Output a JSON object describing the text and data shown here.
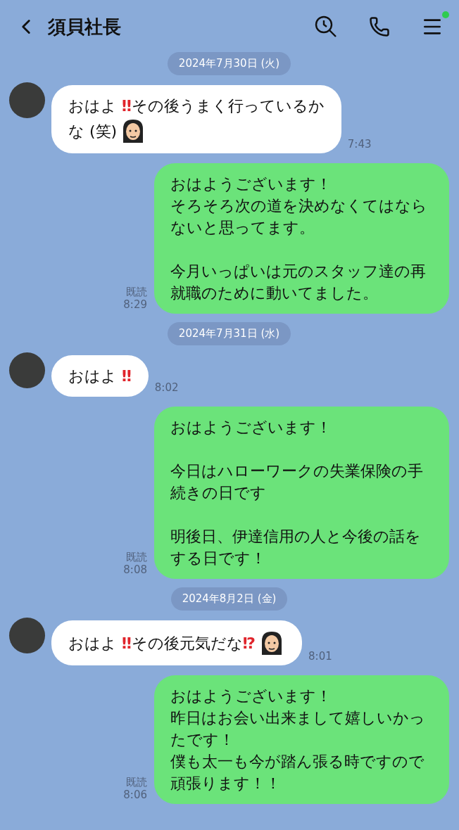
{
  "header": {
    "title": "須貝社長",
    "notification": true
  },
  "messages": [
    {
      "kind": "date",
      "text": "2024年7月30日 (火)"
    },
    {
      "kind": "in",
      "lines": [
        [
          {
            "kind": "text",
            "text": "おはよ "
          },
          {
            "kind": "symbol",
            "text": "‼"
          },
          {
            "kind": "text",
            "text": "その後うまく行っているか"
          }
        ],
        [
          {
            "kind": "text",
            "text": "な (笑)"
          },
          {
            "kind": "emoji"
          }
        ]
      ],
      "time": "7:43"
    },
    {
      "kind": "out",
      "paragraphs": [
        [
          "おはようございます！",
          "そろそろ次の道を決めなくてはなら",
          "ないと思ってます。"
        ],
        [
          "今月いっぱいは元のスタッフ達の再",
          "就職のために動いてました。"
        ]
      ],
      "read": "既読",
      "time": "8:29"
    },
    {
      "kind": "date",
      "text": "2024年7月31日 (水)"
    },
    {
      "kind": "in",
      "lines": [
        [
          {
            "kind": "text",
            "text": "おはよ "
          },
          {
            "kind": "symbol",
            "text": "‼"
          }
        ]
      ],
      "time": "8:02"
    },
    {
      "kind": "out",
      "paragraphs": [
        [
          "おはようございます！"
        ],
        [
          "今日はハローワークの失業保険の手",
          "続きの日です"
        ],
        [
          "明後日、伊達信用の人と今後の話を",
          "する日です！"
        ]
      ],
      "read": "既読",
      "time": "8:08"
    },
    {
      "kind": "date",
      "text": "2024年8月2日 (金)"
    },
    {
      "kind": "in",
      "lines": [
        [
          {
            "kind": "text",
            "text": "おはよ "
          },
          {
            "kind": "symbol",
            "text": "‼"
          },
          {
            "kind": "text",
            "text": "その後元気だな"
          },
          {
            "kind": "symbol",
            "text": "⁉"
          },
          {
            "kind": "emoji"
          }
        ]
      ],
      "time": "8:01"
    },
    {
      "kind": "out",
      "paragraphs": [
        [
          "おはようございます！",
          "昨日はお会い出来まして嬉しいかっ",
          "たです！",
          "僕も太一も今が踏ん張る時ですので",
          "頑張ります！！"
        ]
      ],
      "read": "既読",
      "time": "8:06"
    }
  ]
}
